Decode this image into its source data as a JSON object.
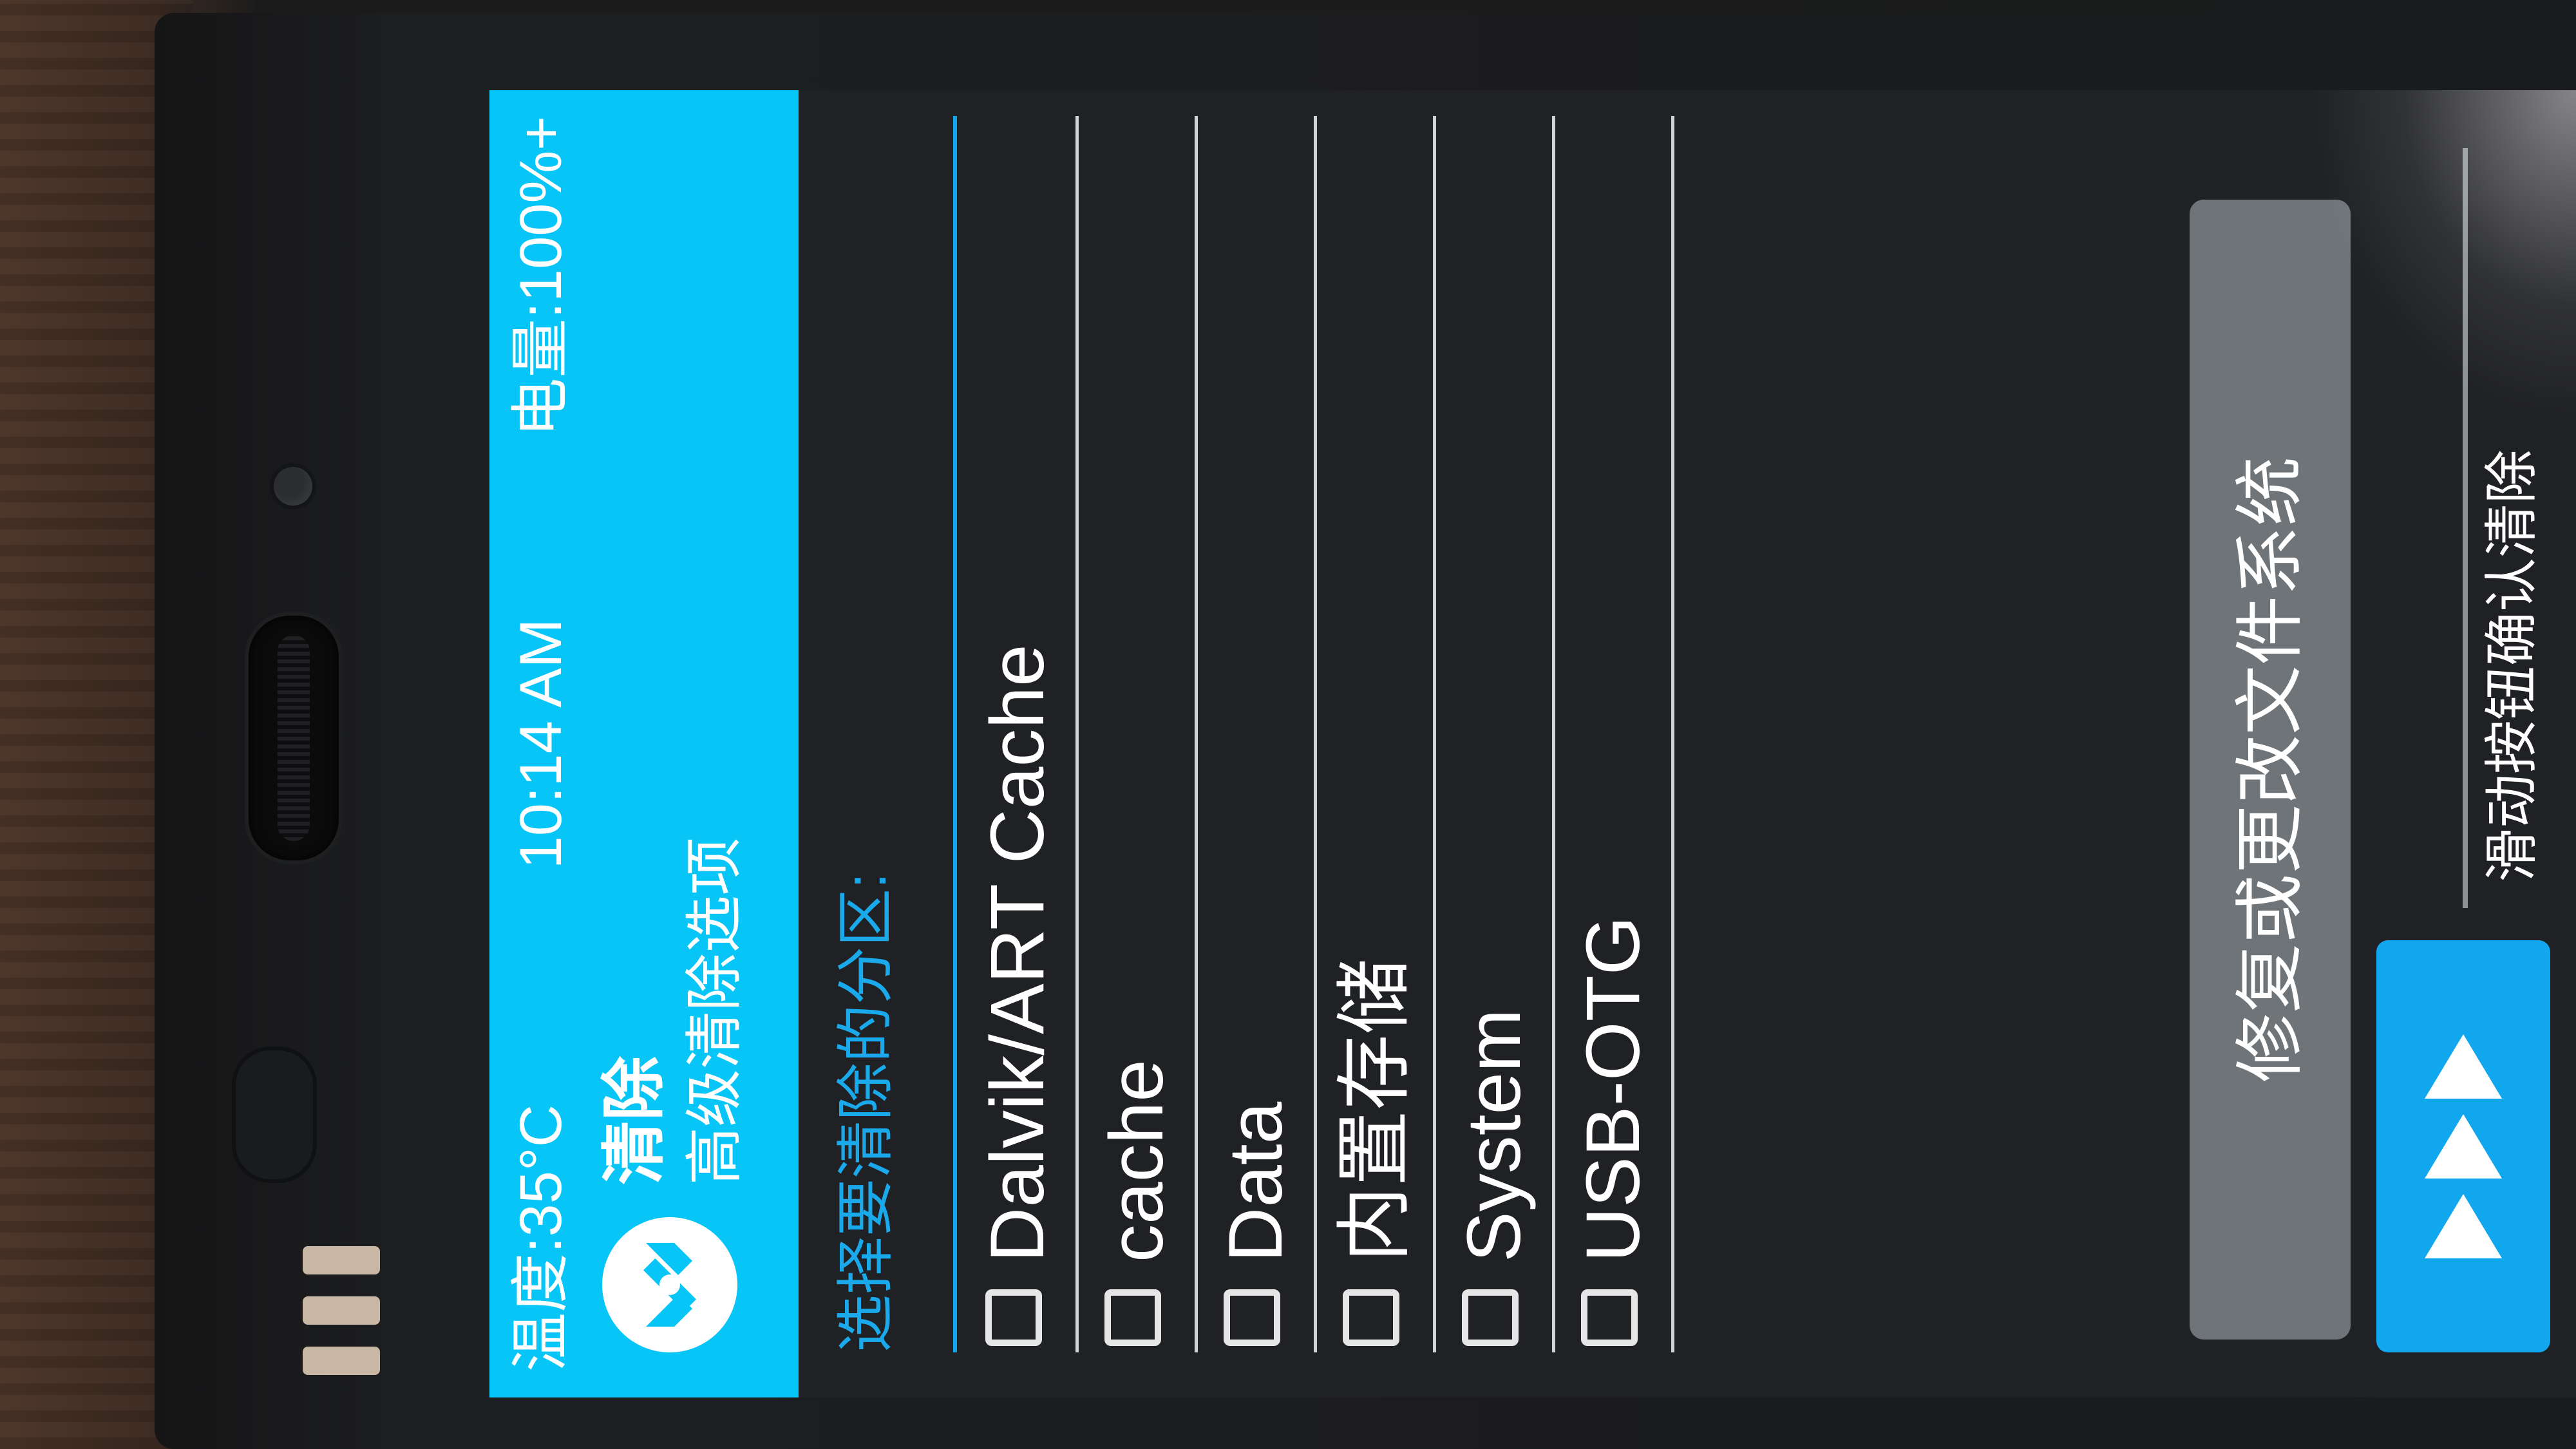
{
  "device": {
    "brand_logo": "mi-logo"
  },
  "status_bar": {
    "temperature": "温度:35°C",
    "time": "10:14 AM",
    "battery": "电量:100%+"
  },
  "header": {
    "app_icon": "twrp-logo-icon",
    "title": "清除",
    "subtitle": "高级清除选项"
  },
  "section": {
    "label": "选择要清除的分区:"
  },
  "partitions": [
    {
      "label": "Dalvik/ART Cache",
      "checked": false
    },
    {
      "label": "cache",
      "checked": false
    },
    {
      "label": "Data",
      "checked": false
    },
    {
      "label": "内置存储",
      "checked": false
    },
    {
      "label": "System",
      "checked": false
    },
    {
      "label": "USB-OTG",
      "checked": false
    }
  ],
  "actions": {
    "repair_button": "修复或更改文件系统",
    "slider_label": "滑动按钮确认清除"
  },
  "colors": {
    "header_bg": "#07c5f6",
    "accent": "#13a6ea",
    "screen_bg": "#202124",
    "button_bg": "#6f7478"
  }
}
